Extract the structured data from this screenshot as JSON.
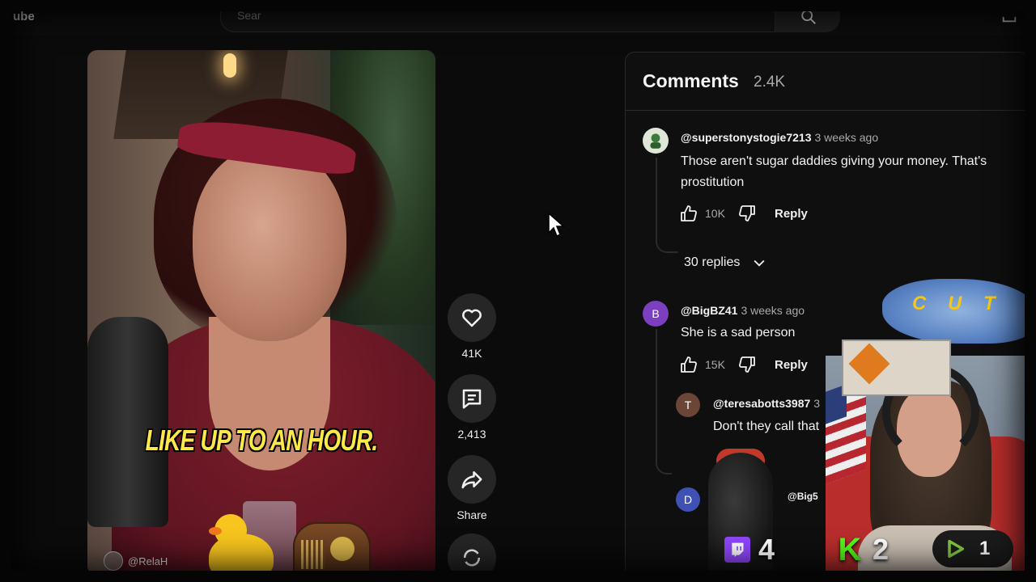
{
  "topbar": {
    "logo_text": "ube",
    "search_placeholder": "Sear"
  },
  "video": {
    "caption": "LIKE UP TO AN HOUR.",
    "channel_name": "@RelaH"
  },
  "actions": {
    "like_count": "41K",
    "comment_count": "2,413",
    "share_label": "Share"
  },
  "comments": {
    "title": "Comments",
    "count": "2.4K",
    "items": [
      {
        "handle": "@superstonystogie7213",
        "time": "3 weeks ago",
        "line1": "Those aren't sugar daddies giving your money. That's",
        "line2": "prostitution",
        "likes": "10K",
        "reply_label": "Reply",
        "replies_toggle": "30 replies"
      },
      {
        "avatar_letter": "B",
        "avatar_color": "#7b3fbf",
        "handle": "@BigBZ41",
        "time": "3 weeks ago",
        "line1": "She is a sad person",
        "likes": "15K",
        "reply_label": "Reply"
      },
      {
        "avatar_letter": "T",
        "avatar_color": "#6b4536",
        "handle": "@teresabotts3987",
        "time": "3",
        "line1": "Don't they call that"
      },
      {
        "avatar_letter": "D",
        "avatar_color": "#3f51b5",
        "handle": "@Big5"
      }
    ]
  },
  "overlay": {
    "cut_text": "C U T",
    "twitch_count": "4",
    "kick_count": "2",
    "rumble_count": "1",
    "colors": {
      "twitch": "#9146ff",
      "kick": "#53fc18",
      "rumble": "#85c742"
    }
  }
}
